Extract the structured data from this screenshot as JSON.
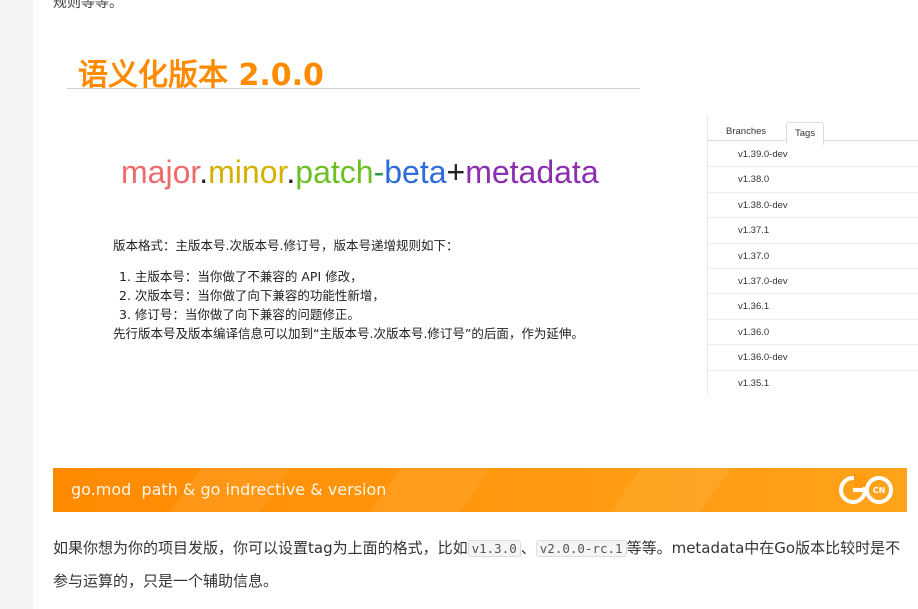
{
  "top_cut_text": "规则等等。",
  "slide": {
    "title": "语义化版本 2.0.0",
    "semver": {
      "major": "major",
      "dot1": ".",
      "minor": "minor",
      "dot2": ".",
      "patch": "patch",
      "dash": "-",
      "beta": "beta",
      "plus": "+",
      "metadata": "metadata"
    },
    "format_line": "版本格式：主版本号.次版本号.修订号，版本号递增规则如下：",
    "rules": [
      "1. 主版本号：当你做了不兼容的 API 修改，",
      "2. 次版本号：当你做了向下兼容的功能性新增，",
      "3. 修订号：当你做了向下兼容的问题修正。"
    ],
    "extra_line": "先行版本号及版本编译信息可以加到“主版本号.次版本号.修订号”的后面，作为延伸。"
  },
  "tags_panel": {
    "tab_branches": "Branches",
    "tab_tags": "Tags",
    "active_tab": "Tags",
    "tags": [
      "v1.39.0-dev",
      "v1.38.0",
      "v1.38.0-dev",
      "v1.37.1",
      "v1.37.0",
      "v1.37.0-dev",
      "v1.36.1",
      "v1.36.0",
      "v1.36.0-dev",
      "v1.35.1"
    ]
  },
  "banner": {
    "text": "go.mod  path & go indrective & version",
    "logo_text": "GO",
    "logo_badge": "CN",
    "color": "#ff8a00"
  },
  "paragraph": {
    "part1": "如果你想为你的项目发版，你可以设置tag为上面的格式，比如",
    "code1": "v1.3.0",
    "sep": "、",
    "code2": "v2.0.0-rc.1",
    "part2": "等等。metadata中在Go版本比较时是不参与运算的，只是一个辅助信息。"
  }
}
